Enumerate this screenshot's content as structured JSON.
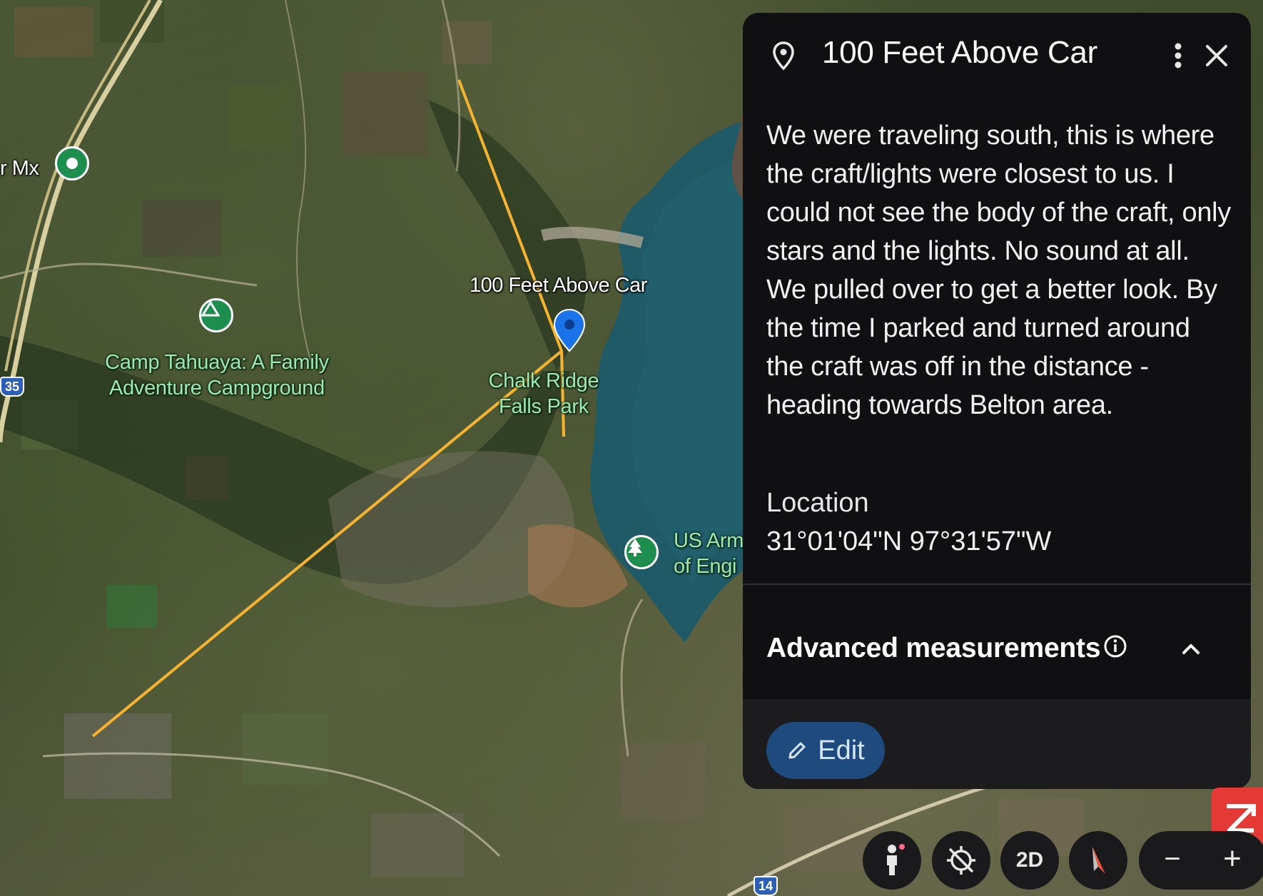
{
  "map": {
    "placemark_label": "100 Feet Above Car",
    "poi": [
      {
        "name": "Camp Tahuaya: A Family\nAdventure Campground",
        "line1": "Camp Tahuaya: A Family",
        "line2": "Adventure Campground",
        "kind": "campground-icon"
      },
      {
        "name": "Chalk Ridge Falls Park",
        "line1": "Chalk Ridge",
        "line2": "Falls Park",
        "kind": "park"
      },
      {
        "name": "US Army Corps of Engineers",
        "line1": "US Arm",
        "line2": "of Engi",
        "kind": "tree-icon"
      },
      {
        "name": "r Mx",
        "line1": "r Mx",
        "kind": "place-icon"
      }
    ],
    "road_shields": [
      "35",
      "14"
    ],
    "colors": {
      "path": "#f4b431",
      "water": "#1f5a66",
      "pin": "#1a73e8"
    }
  },
  "panel": {
    "title": "100 Feet Above Car",
    "description": "We were traveling south, this is where the craft/lights were closest to us. I could not see the body of the craft, only stars and the lights. No sound at all. We pulled over to get a better look. By the time I parked and turned around the craft was off in the distance - heading towards Belton area.",
    "location_heading": "Location",
    "location_value": "31°01'04\"N 97°31'57\"W",
    "advanced_label": "Advanced measurements",
    "edit_label": "Edit"
  },
  "controls": {
    "view_mode": "2D",
    "zoom_out": "−",
    "zoom_in": "+"
  }
}
